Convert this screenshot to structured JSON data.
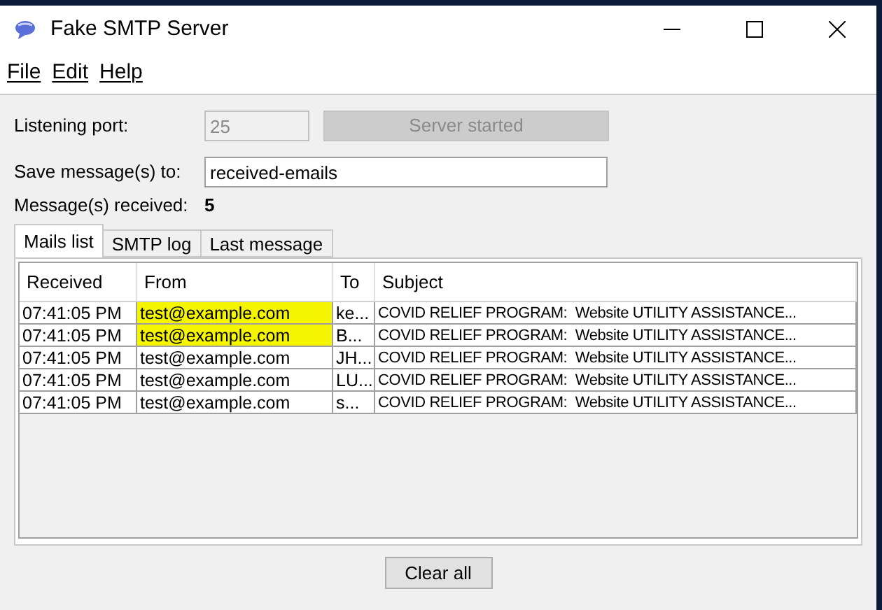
{
  "window": {
    "title": "Fake SMTP Server"
  },
  "menu": [
    "File",
    "Edit",
    "Help"
  ],
  "listening_port": {
    "label": "Listening port:",
    "value": "25",
    "disabled": true
  },
  "server_button": {
    "label": "Server started",
    "disabled": true
  },
  "save_to": {
    "label": "Save message(s) to:",
    "value": "received-emails"
  },
  "received": {
    "label": "Message(s) received:",
    "value": "5"
  },
  "tabs": [
    {
      "label": "Mails list",
      "selected": true
    },
    {
      "label": "SMTP log",
      "selected": false
    },
    {
      "label": "Last message",
      "selected": false
    }
  ],
  "table": {
    "columns": [
      "Received",
      "From",
      "To",
      "Subject"
    ],
    "rows": [
      {
        "received": "07:41:05 PM",
        "from": "test@example.com",
        "to": "ke...",
        "subject": "COVID RELIEF PROGRAM:  Website UTILITY ASSISTANCE...",
        "highlighted": true
      },
      {
        "received": "07:41:05 PM",
        "from": "test@example.com",
        "to": "B...",
        "subject": "COVID RELIEF PROGRAM:  Website UTILITY ASSISTANCE...",
        "highlighted": true
      },
      {
        "received": "07:41:05 PM",
        "from": "test@example.com",
        "to": "JH...",
        "subject": "COVID RELIEF PROGRAM:  Website UTILITY ASSISTANCE...",
        "highlighted": false
      },
      {
        "received": "07:41:05 PM",
        "from": "test@example.com",
        "to": "LU...",
        "subject": "COVID RELIEF PROGRAM:  Website UTILITY ASSISTANCE...",
        "highlighted": false
      },
      {
        "received": "07:41:05 PM",
        "from": "test@example.com",
        "to": "s...",
        "subject": "COVID RELIEF PROGRAM:  Website UTILITY ASSISTANCE...",
        "highlighted": false
      }
    ]
  },
  "clear_button": "Clear all"
}
